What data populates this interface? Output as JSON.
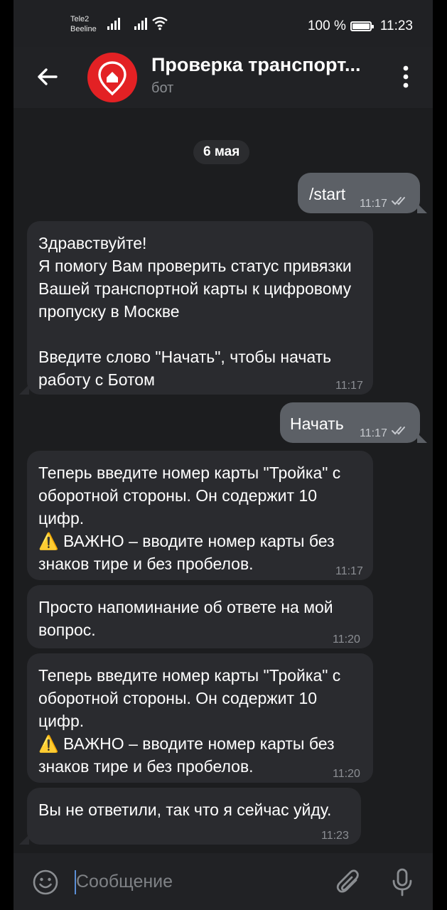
{
  "status_bar": {
    "carrier1": "Tele2",
    "carrier2": "Beeline",
    "battery": "100 %",
    "time": "11:23"
  },
  "header": {
    "title": "Проверка транспорт...",
    "subtitle": "бот",
    "avatar_color": "#e32124"
  },
  "chat": {
    "date": "6 мая",
    "messages": [
      {
        "direction": "out",
        "text": "/start",
        "time": "11:17",
        "read": true
      },
      {
        "direction": "in",
        "text": "Здравствуйте!\nЯ помогу Вам проверить статус привязки Вашей транспортной карты к цифровому пропуску в Москве\n\nВведите слово \"Начать\", чтобы начать работу с Ботом",
        "time": "11:17"
      },
      {
        "direction": "out",
        "text": "Начать",
        "time": "11:17",
        "read": true
      },
      {
        "direction": "in",
        "text": "Теперь введите номер карты \"Тройка\" с оборотной стороны. Он содержит 10 цифр.\n⚠️ ВАЖНО – вводите номер карты без знаков тире и без пробелов.",
        "time": "11:17"
      },
      {
        "direction": "in",
        "text": "Просто напоминание об ответе на мой вопрос.",
        "time": "11:20"
      },
      {
        "direction": "in",
        "text": "Теперь введите номер карты \"Тройка\" с оборотной стороны. Он содержит 10 цифр.\n⚠️ ВАЖНО – вводите номер карты без знаков тире и без пробелов.",
        "time": "11:20"
      },
      {
        "direction": "in",
        "text": "Вы не ответили, так что я сейчас уйду.",
        "time": "11:23"
      }
    ]
  },
  "composer": {
    "placeholder": "Сообщение"
  },
  "icons": {
    "back": "arrow-left-icon",
    "menu": "more-vertical-icon",
    "emoji": "smile-icon",
    "attach": "paperclip-icon",
    "mic": "microphone-icon"
  }
}
